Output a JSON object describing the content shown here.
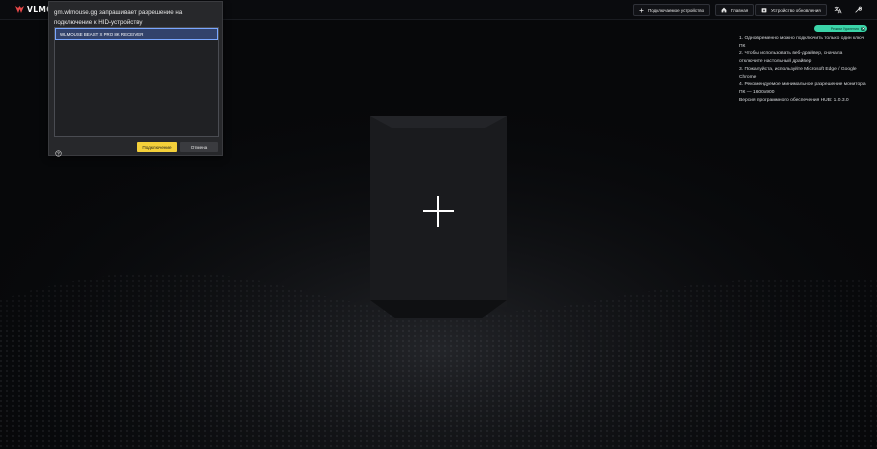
{
  "app": {
    "logo_text": "VLMO"
  },
  "header": {
    "connect_device_label": "Подключаемое устройство",
    "home_label": "Главная",
    "update_label": "Устройство обновления"
  },
  "toggle": {
    "label": "Режим Удаления"
  },
  "instructions": {
    "line1": "1. Одновременно можно подключить только один ключ ПК",
    "line2": "2. Чтобы использовать веб-драйвер, сначала отключите настольный драйвер",
    "line3": "3. Пожалуйста, используйте Microsoft Edge / Google Chrome",
    "line4": "4. Рекомендуемое минимальное разрешение монитора ПК — 1600x900",
    "line5": "Версия программного обеспечения HUB: 1.0.3.0"
  },
  "dialog": {
    "title": "gm.wlmouse.gg запрашивает разрешение на подключение к HID-устройству",
    "devices": [
      "WLMOUSE BEAST X PRO 8K RECEIVER"
    ],
    "connect_label": "Подключение",
    "cancel_label": "Отмена"
  },
  "colors": {
    "accent_yellow": "#f4d03a",
    "toggle_green": "#3bd4a8",
    "selected_item": "#32426b",
    "background": "#07080a"
  }
}
